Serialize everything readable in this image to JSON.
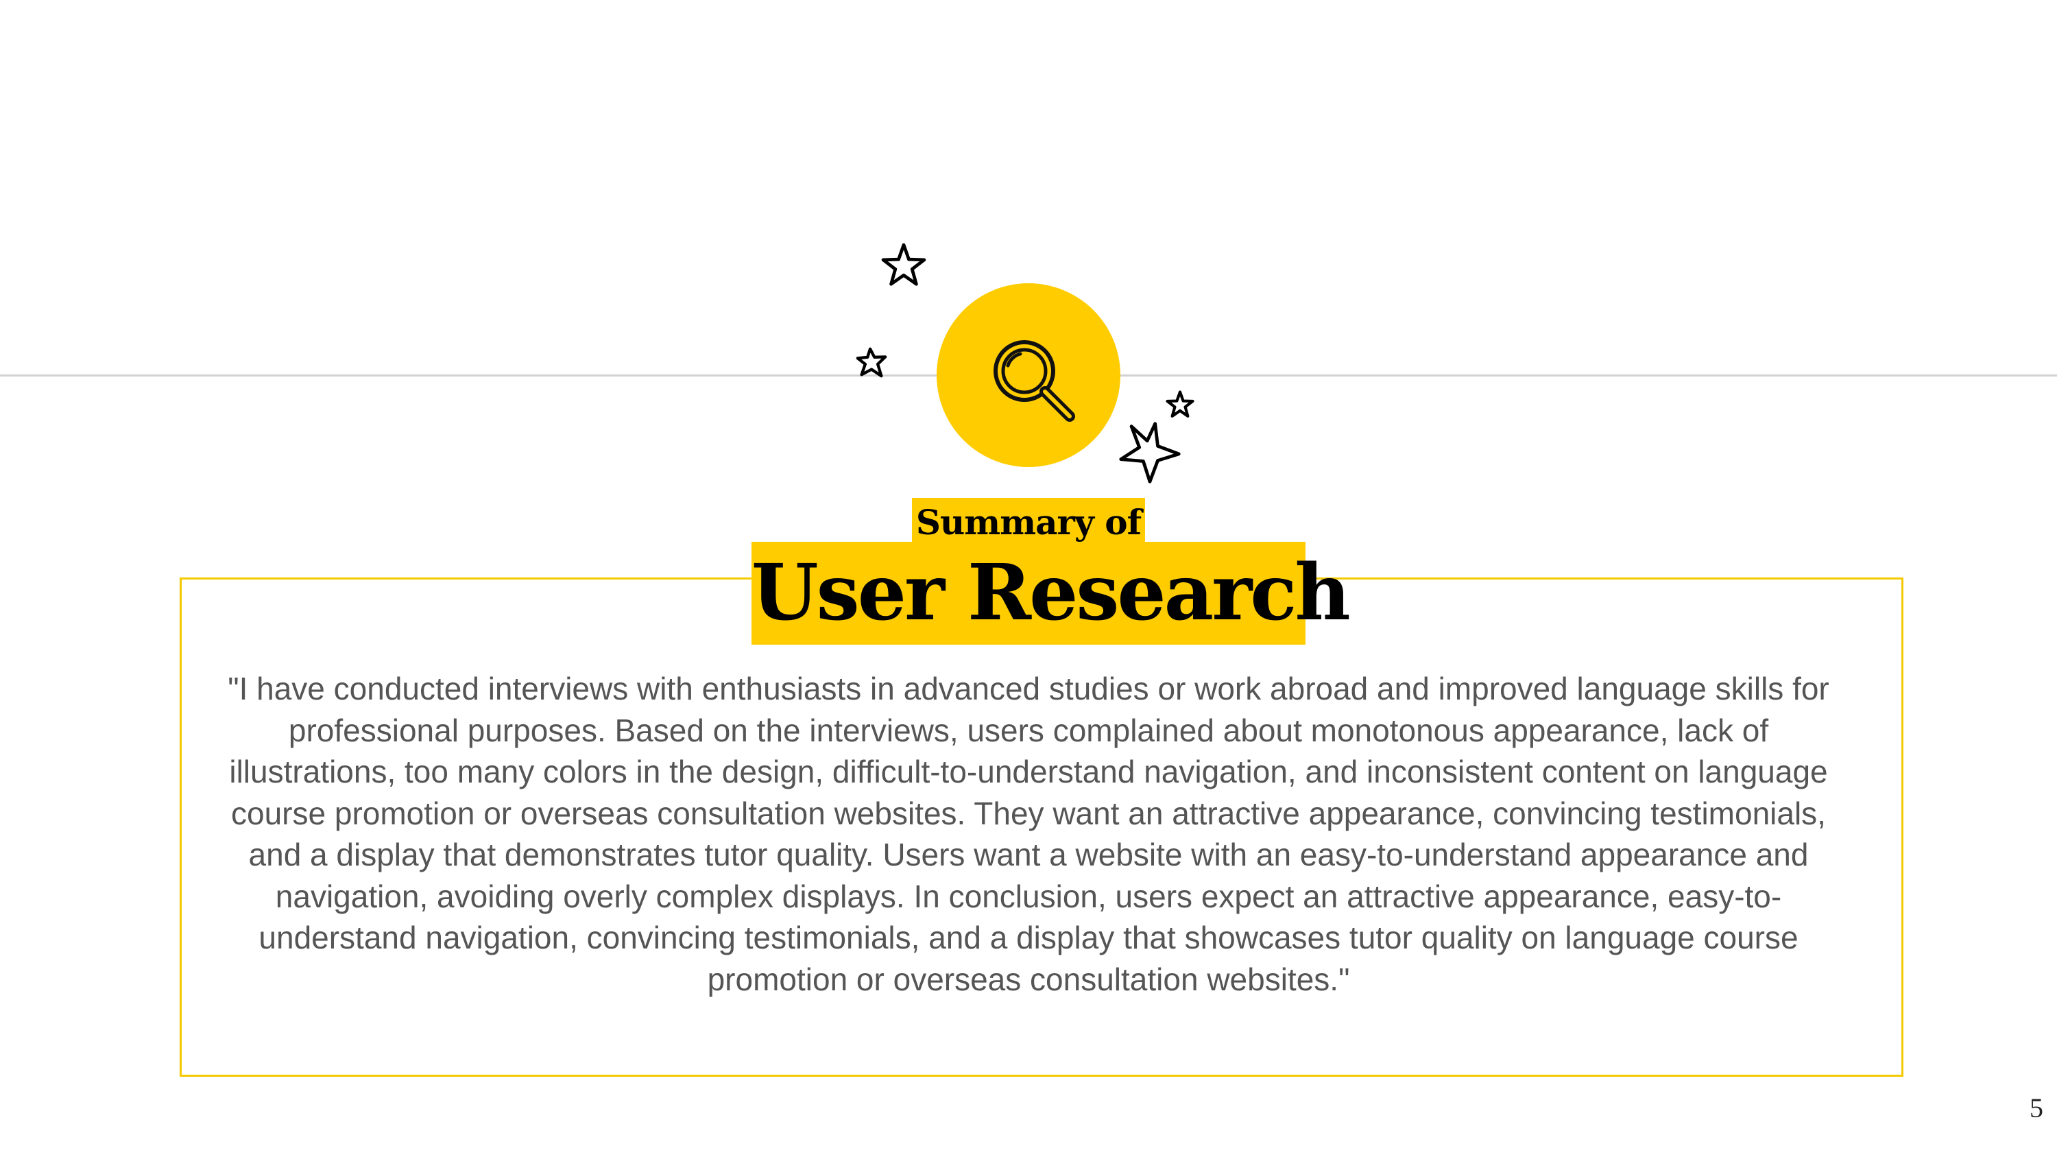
{
  "slide": {
    "subtitle": "Summary of",
    "title": "User Research",
    "quote": "\"I have conducted interviews with enthusiasts in advanced studies or work abroad and improved language skills for professional purposes. Based on the interviews, users complained about monotonous appearance, lack of illustrations, too many colors in the design, difficult-to-understand navigation, and inconsistent content on language course promotion or overseas consultation websites. They want an attractive appearance, convincing testimonials, and a display that demonstrates tutor quality. Users want a website with an easy-to-understand appearance and navigation, avoiding overly complex displays. In conclusion, users expect an attractive appearance, easy-to-understand navigation, convincing testimonials, and a display that showcases tutor quality on language course promotion or overseas consultation websites.\"",
    "page_number": "5"
  },
  "icons": {
    "main": "magnifying-glass-icon",
    "decorations": [
      "star-icon",
      "star-icon",
      "star-icon",
      "star-icon"
    ]
  },
  "colors": {
    "accent": "#ffcc00",
    "box_border": "#f5c900",
    "body_text": "#555555",
    "divider": "#d2d2d2"
  }
}
